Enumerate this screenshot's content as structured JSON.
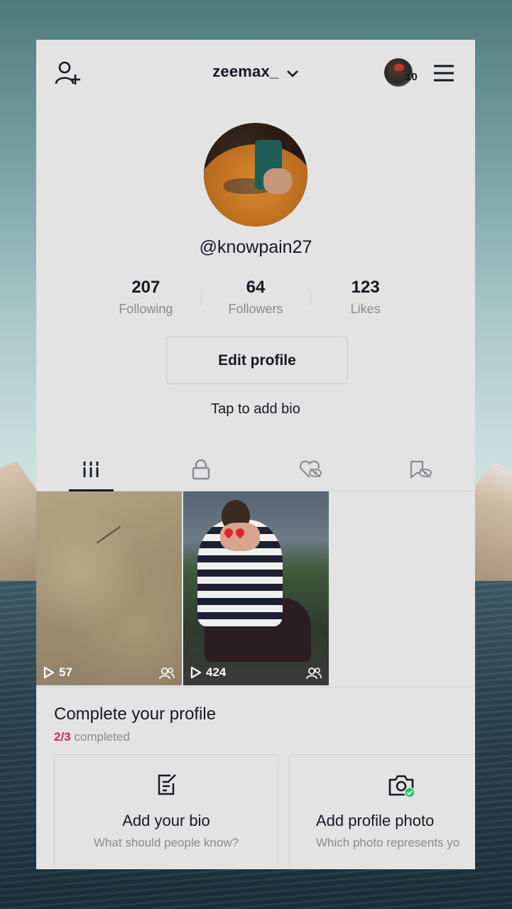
{
  "header": {
    "username": "zeemax_",
    "story_count": "10"
  },
  "profile": {
    "handle": "@knowpain27",
    "stats": [
      {
        "value": "207",
        "label": "Following"
      },
      {
        "value": "64",
        "label": "Followers"
      },
      {
        "value": "123",
        "label": "Likes"
      }
    ],
    "edit_button": "Edit profile",
    "bio_prompt": "Tap to add bio"
  },
  "tabs": [
    {
      "icon": "grid-icon",
      "active": true
    },
    {
      "icon": "lock-icon",
      "active": false
    },
    {
      "icon": "hidden-likes-icon",
      "active": false
    },
    {
      "icon": "hidden-favorites-icon",
      "active": false
    }
  ],
  "videos": [
    {
      "views": "57",
      "visibility_icon": "friends-icon"
    },
    {
      "views": "424",
      "visibility_icon": "friends-icon"
    }
  ],
  "complete_profile": {
    "title": "Complete your profile",
    "progress_done": "2/3",
    "progress_text": "completed",
    "cards": [
      {
        "icon": "edit-note-icon",
        "title": "Add your bio",
        "subtitle": "What should people know?"
      },
      {
        "icon": "camera-check-icon",
        "title": "Add profile photo",
        "subtitle": "Which photo represents yo"
      }
    ]
  },
  "colors": {
    "text": "#161823",
    "muted": "#8a8b91",
    "accent_red": "#e0244f",
    "check_green": "#20c864"
  }
}
